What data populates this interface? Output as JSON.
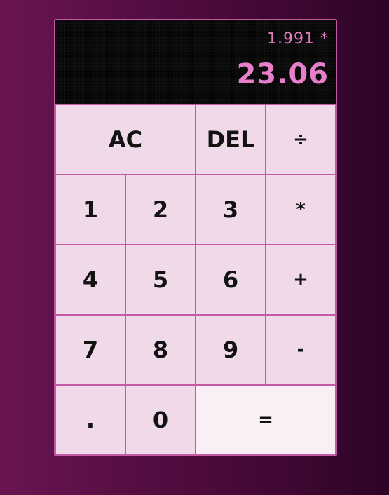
{
  "display": {
    "previous_operand": "1.991 *",
    "current_operand": "23.06"
  },
  "keys": {
    "all_clear": "AC",
    "delete": "DEL",
    "divide": "÷",
    "one": "1",
    "two": "2",
    "three": "3",
    "multiply": "*",
    "four": "4",
    "five": "5",
    "six": "6",
    "plus": "+",
    "seven": "7",
    "eight": "8",
    "nine": "9",
    "minus": "-",
    "decimal": ".",
    "zero": "0",
    "equals": "="
  },
  "colors": {
    "accent": "#c45aa3",
    "display_text": "#e87fca",
    "key_background": "#f0d9e8",
    "equals_background": "#f9eff5",
    "display_background": "#050505"
  }
}
